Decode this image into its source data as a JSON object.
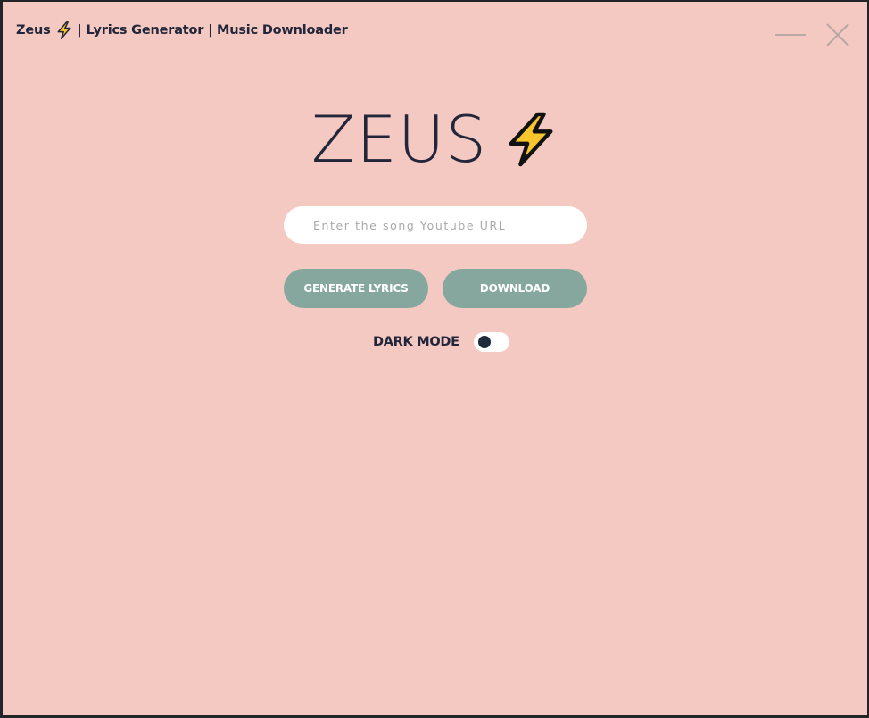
{
  "window": {
    "title_prefix": "Zeus",
    "title_suffix": "| Lyrics Generator | Music Downloader",
    "title_icon": "lightning-bolt-icon",
    "controls": {
      "minimize_icon": "minimize-icon",
      "close_icon": "close-icon"
    }
  },
  "logo": {
    "text": "ZEUS",
    "icon": "lightning-bolt-icon"
  },
  "search": {
    "placeholder": "Enter the song Youtube URL",
    "value": ""
  },
  "actions": {
    "generate_label": "GENERATE LYRICS",
    "download_label": "DOWNLOAD"
  },
  "dark_mode": {
    "label": "DARK MODE",
    "enabled": false
  },
  "colors": {
    "background": "#f4c9c2",
    "button": "#86a79d",
    "text": "#23263a",
    "bolt_fill": "#f8c52c"
  }
}
